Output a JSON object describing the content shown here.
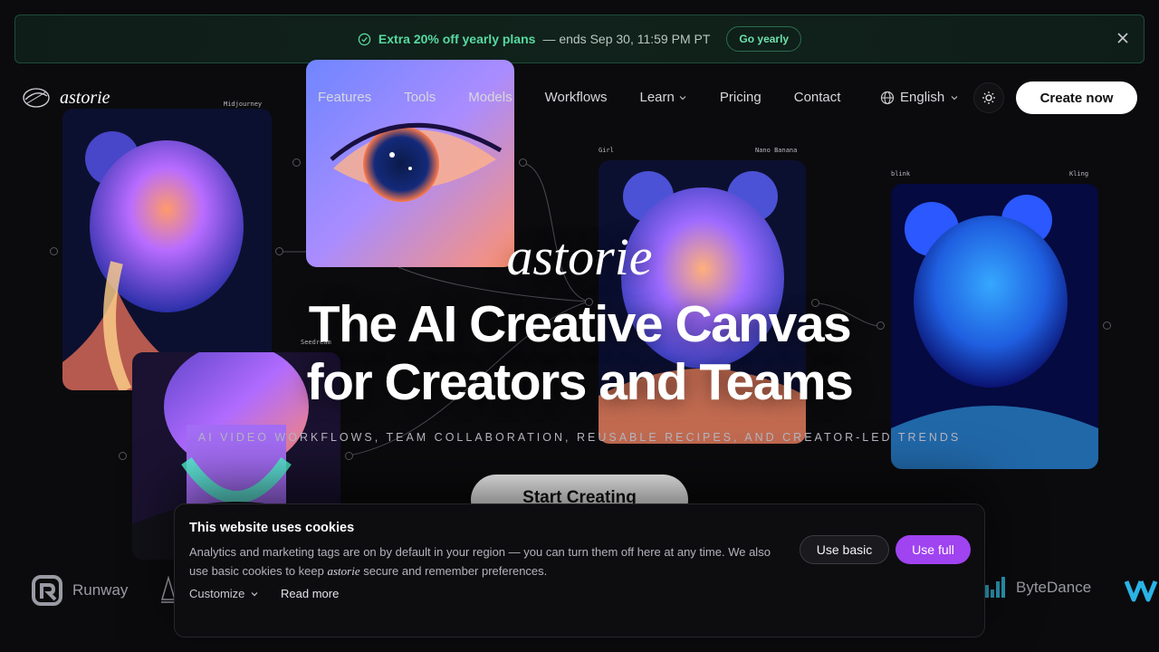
{
  "promo": {
    "highlight": "Extra 20% off yearly plans",
    "rest": "— ends Sep 30, 11:59 PM PT",
    "button": "Go yearly"
  },
  "header": {
    "brand": "astorie",
    "nav": [
      "Features",
      "Tools",
      "Models",
      "Workflows",
      "Learn",
      "Pricing",
      "Contact"
    ],
    "language": "English",
    "cta": "Create now"
  },
  "canvas": {
    "labels": {
      "card1_model": "Midjourney",
      "card3_title": "Girl",
      "card3_model": "Nano Banana",
      "card4_title": "blink",
      "card4_model": "Kling",
      "card5_model": "Seedream"
    }
  },
  "hero": {
    "logo": "astorie",
    "title_line1": "The AI Creative Canvas",
    "title_line2": "for Creators and Teams",
    "subtitle": "AI VIDEO WORKFLOWS, TEAM COLLABORATION, REUSABLE RECIPES, AND CREATOR-LED TRENDS",
    "cta": "Start Creating"
  },
  "partners": [
    "Runway",
    "ByteDance"
  ],
  "cookie": {
    "title": "This website uses cookies",
    "text_before": "Analytics and marketing tags are on by default in your region — you can turn them off here at any time. We also use basic cookies to keep ",
    "brand": "astorie",
    "text_after": " secure and remember preferences.",
    "customize": "Customize",
    "read_more": "Read more",
    "use_basic": "Use basic",
    "use_full": "Use full"
  },
  "colors": {
    "accent_green": "#57d9a0",
    "accent_purple": "#a043f0"
  }
}
